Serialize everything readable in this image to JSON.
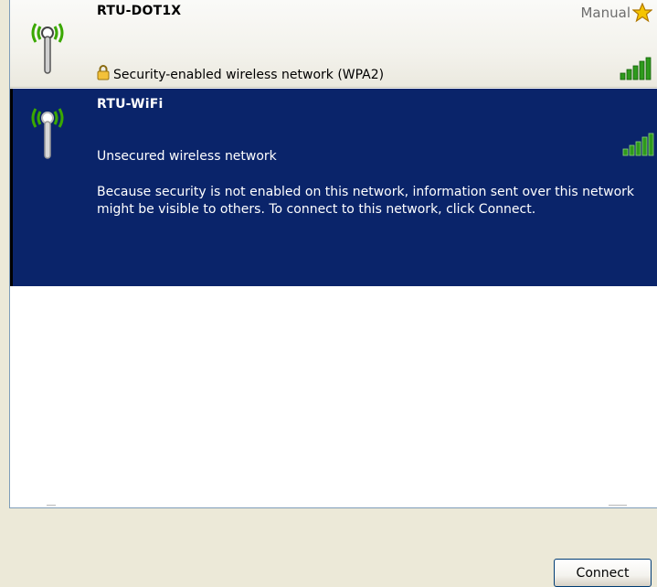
{
  "networks": [
    {
      "name": "RTU-DOT1X",
      "connection_mode": "Manual",
      "security": "Security-enabled wireless network (WPA2)",
      "secured": true,
      "selected": false,
      "signal_bars": 5,
      "signal_max": 5
    },
    {
      "name": "RTU-WiFi",
      "security": "Unsecured wireless network",
      "secured": false,
      "selected": true,
      "signal_bars": 5,
      "signal_max": 5,
      "description": "Because security is not enabled on this network, information sent over this network might be visible to others. To connect to this network, click Connect."
    }
  ],
  "actions": {
    "connect_label": "Connect"
  },
  "colors": {
    "selection": "#0a246a",
    "signal_green": "#2e9a1c",
    "antenna_waves": "#3aa800",
    "star": "#f5c400"
  },
  "icons": [
    "antenna-icon",
    "star-icon",
    "lock-icon",
    "signal-strength-icon"
  ]
}
